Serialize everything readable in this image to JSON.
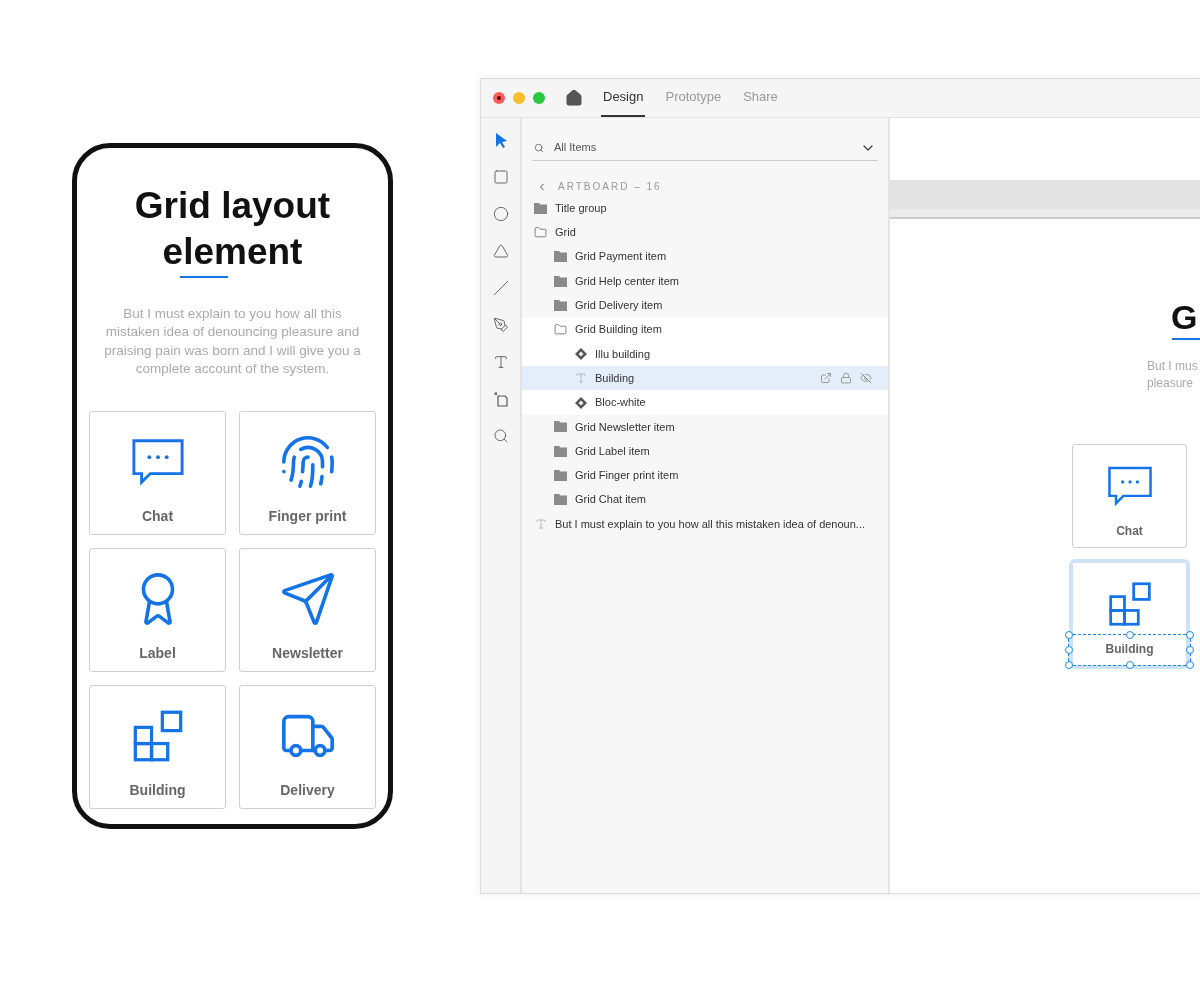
{
  "phone": {
    "title": "Grid layout element",
    "description": "But I must explain to you how all this mistaken idea of denouncing pleasure and praising pain was born and I will give you a complete account of the system.",
    "cards": [
      {
        "label": "Chat",
        "kind": "chat"
      },
      {
        "label": "Finger print",
        "kind": "fingerprint"
      },
      {
        "label": "Label",
        "kind": "label"
      },
      {
        "label": "Newsletter",
        "kind": "newsletter"
      },
      {
        "label": "Building",
        "kind": "building"
      },
      {
        "label": "Delivery",
        "kind": "delivery"
      }
    ]
  },
  "window": {
    "tabs": [
      {
        "label": "Design",
        "selected": true
      },
      {
        "label": "Prototype",
        "selected": false
      },
      {
        "label": "Share",
        "selected": false
      }
    ],
    "tools": [
      {
        "kind": "select",
        "selected": true
      },
      {
        "kind": "rectangle",
        "selected": false
      },
      {
        "kind": "ellipse",
        "selected": false
      },
      {
        "kind": "polygon",
        "selected": false
      },
      {
        "kind": "line",
        "selected": false
      },
      {
        "kind": "pen",
        "selected": false
      },
      {
        "kind": "text",
        "selected": false
      },
      {
        "kind": "artboard",
        "selected": false
      },
      {
        "kind": "zoom",
        "selected": false
      }
    ],
    "layers": {
      "filter": "All Items",
      "breadcrumb": "ARTBOARD – 16",
      "items": [
        {
          "label": "Title group",
          "kind": "group",
          "expanded": false,
          "selected": false
        },
        {
          "label": "Grid",
          "kind": "group",
          "expanded": true,
          "selected": false,
          "children": [
            {
              "label": "Grid Payment item",
              "kind": "group",
              "expanded": false,
              "selected": false
            },
            {
              "label": "Grid Help center item",
              "kind": "group",
              "expanded": false,
              "selected": false
            },
            {
              "label": "Grid Delivery item",
              "kind": "group",
              "expanded": false,
              "selected": false
            },
            {
              "label": "Grid Building item",
              "kind": "group",
              "expanded": true,
              "selected": false,
              "children": [
                {
                  "label": "Illu building",
                  "kind": "component",
                  "selected": false
                },
                {
                  "label": "Building",
                  "kind": "text",
                  "selected": true
                },
                {
                  "label": "Bloc-white",
                  "kind": "component",
                  "selected": false
                }
              ]
            },
            {
              "label": "Grid Newsletter item",
              "kind": "group",
              "expanded": false,
              "selected": false
            },
            {
              "label": "Grid Label item",
              "kind": "group",
              "expanded": false,
              "selected": false
            },
            {
              "label": "Grid Finger print item",
              "kind": "group",
              "expanded": false,
              "selected": false
            },
            {
              "label": "Grid Chat item",
              "kind": "group",
              "expanded": false,
              "selected": false
            }
          ]
        },
        {
          "label": "But I must explain to you how all this mistaken idea of denoun...",
          "kind": "text",
          "selected": false
        }
      ]
    },
    "canvas": {
      "title": "G",
      "paragraph_lines": [
        "But I mus",
        "pleasure"
      ],
      "cards": [
        {
          "label": "Chat",
          "kind": "chat",
          "selected": false
        },
        {
          "label": "Building",
          "kind": "building",
          "selected": true
        }
      ]
    }
  }
}
